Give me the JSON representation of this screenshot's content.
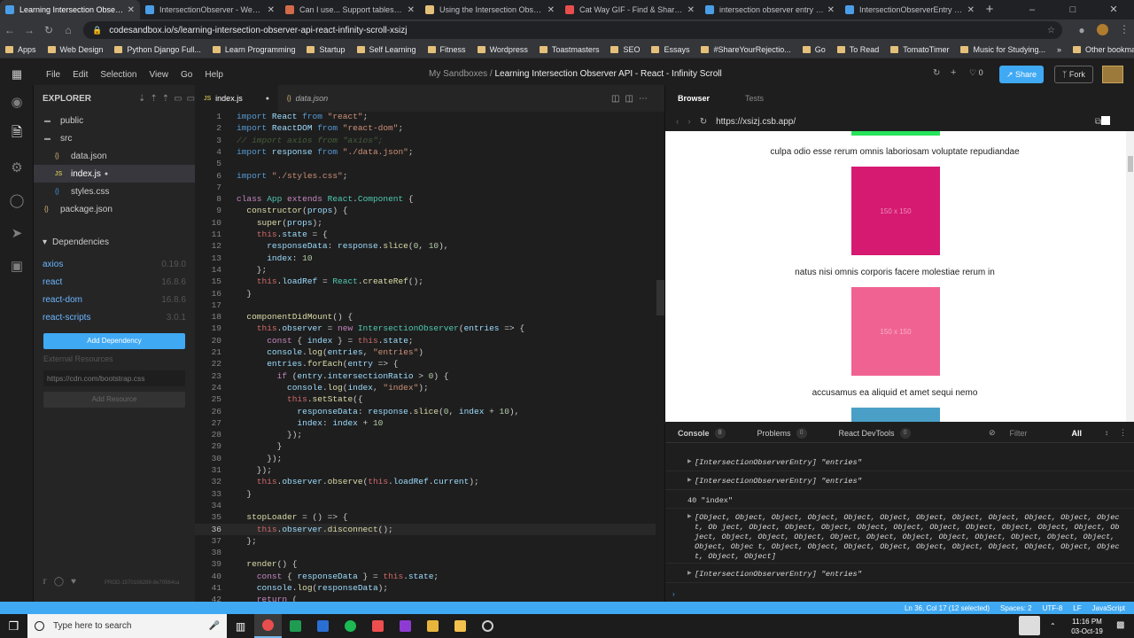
{
  "browser": {
    "tabs": [
      {
        "title": "Learning Intersection Observer A",
        "fav": "#4a9ee8",
        "active": true
      },
      {
        "title": "IntersectionObserver - Web APIs",
        "fav": "#4a9ee8"
      },
      {
        "title": "Can I use... Support tables for HT",
        "fav": "#d36a4a"
      },
      {
        "title": "Using the Intersection Observer",
        "fav": "#e5c07b"
      },
      {
        "title": "Cat Way GIF - Find & Share on Gi",
        "fav": "#e94e4e"
      },
      {
        "title": "intersection observer entry - Goo",
        "fav": "#4a9ee8"
      },
      {
        "title": "IntersectionObserverEntry - Web",
        "fav": "#4a9ee8"
      }
    ],
    "url": "codesandbox.io/s/learning-intersection-observer-api-react-infinity-scroll-xsizj",
    "bookmarks": [
      "Apps",
      "Web Design",
      "Python Django Full...",
      "Learn Programming",
      "Startup",
      "Self Learning",
      "Fitness",
      "Wordpress",
      "Toastmasters",
      "SEO",
      "Essays",
      "#ShareYourRejectio...",
      "Go",
      "To Read",
      "TomatoTimer",
      "Music for Studying..."
    ],
    "other_bookmarks": "Other bookmarks"
  },
  "csb": {
    "menu": [
      "File",
      "Edit",
      "Selection",
      "View",
      "Go",
      "Help"
    ],
    "breadcrumb_prefix": "My Sandboxes /",
    "sandbox_title": "Learning Intersection Observer API - React - Infinity Scroll",
    "likes": "0",
    "share": "Share",
    "fork": "Fork"
  },
  "explorer": {
    "title": "EXPLORER",
    "files": [
      {
        "name": "public",
        "type": "folder",
        "indent": 0
      },
      {
        "name": "src",
        "type": "folder",
        "indent": 0
      },
      {
        "name": "data.json",
        "type": "json",
        "indent": 1
      },
      {
        "name": "index.js",
        "type": "js",
        "indent": 1,
        "active": true
      },
      {
        "name": "styles.css",
        "type": "css",
        "indent": 1
      },
      {
        "name": "package.json",
        "type": "json",
        "indent": 0
      }
    ],
    "dependencies_title": "Dependencies",
    "dependencies": [
      {
        "name": "axios",
        "version": "0.19.0"
      },
      {
        "name": "react",
        "version": "16.8.6"
      },
      {
        "name": "react-dom",
        "version": "16.8.6"
      },
      {
        "name": "react-scripts",
        "version": "3.0.1"
      }
    ],
    "add_dependency": "Add Dependency",
    "external_resources": "External Resources",
    "external_placeholder": "https://cdn.com/bootstrap.css",
    "add_resource": "Add Resource",
    "footer_id": "PROD-1570108289-8e70564ca"
  },
  "editor": {
    "tabs": [
      {
        "name": "index.js",
        "active": true
      },
      {
        "name": "data.json"
      }
    ],
    "current_line": 36,
    "lines": [
      "<span class='k'>import</span> <span class='v'>React</span> <span class='k'>from</span> <span class='s'>\"react\"</span>;",
      "<span class='k'>import</span> <span class='v'>ReactDOM</span> <span class='k'>from</span> <span class='s'>\"react-dom\"</span>;",
      "<span class='c'>// import axios from \"axios\";</span>",
      "<span class='k'>import</span> <span class='v'>response</span> <span class='k'>from</span> <span class='s'>\"./data.json\"</span>;",
      "",
      "<span class='k'>import</span> <span class='s'>\"./styles.css\"</span>;",
      "",
      "<span class='kw'>class</span> <span class='t'>App</span> <span class='kw'>extends</span> <span class='t'>React</span>.<span class='t'>Component</span> {",
      "  <span class='f'>constructor</span>(<span class='v'>props</span>) {",
      "    <span class='f'>super</span>(<span class='v'>props</span>);",
      "    <span class='th'>this</span>.<span class='v'>state</span> = {",
      "      <span class='v'>responseData</span>: <span class='v'>response</span>.<span class='f'>slice</span>(<span class='n'>0</span>, <span class='n'>10</span>),",
      "      <span class='v'>index</span>: <span class='n'>10</span>",
      "    };",
      "    <span class='th'>this</span>.<span class='v'>loadRef</span> = <span class='t'>React</span>.<span class='f'>createRef</span>();",
      "  }",
      "",
      "  <span class='f'>componentDidMount</span>() {",
      "    <span class='th'>this</span>.<span class='v'>observer</span> = <span class='kw'>new</span> <span class='t'>IntersectionObserver</span>(<span class='v'>entries</span> =&gt; {",
      "      <span class='kw'>const</span> { <span class='v'>index</span> } = <span class='th'>this</span>.<span class='v'>state</span>;",
      "      <span class='v'>console</span>.<span class='f'>log</span>(<span class='v'>entries</span>, <span class='s'>\"entries\"</span>)",
      "      <span class='v'>entries</span>.<span class='f'>forEach</span>(<span class='v'>entry</span> =&gt; {",
      "        <span class='kw'>if</span> (<span class='v'>entry</span>.<span class='v'>intersectionRatio</span> &gt; <span class='n'>0</span>) {",
      "          <span class='v'>console</span>.<span class='f'>log</span>(<span class='v'>index</span>, <span class='s'>\"index\"</span>);",
      "          <span class='th'>this</span>.<span class='f'>setState</span>({",
      "            <span class='v'>responseData</span>: <span class='v'>response</span>.<span class='f'>slice</span>(<span class='n'>0</span>, <span class='v'>index</span> + <span class='n'>10</span>),",
      "            <span class='v'>index</span>: <span class='v'>index</span> + <span class='n'>10</span>",
      "          });",
      "        }",
      "      });",
      "    });",
      "    <span class='th'>this</span>.<span class='v'>observer</span>.<span class='f'>observe</span>(<span class='th'>this</span>.<span class='v'>loadRef</span>.<span class='v'>current</span>);",
      "  }",
      "",
      "  <span class='f'>stopLoader</span> = () =&gt; {",
      "    <span class='th'>this</span>.<span class='v'>observer</span>.<span class='f'>disconnect</span>();",
      "  };",
      "",
      "  <span class='f'>render</span>() {",
      "    <span class='kw'>const</span> { <span class='v'>responseData</span> } = <span class='th'>this</span>.<span class='v'>state</span>;",
      "    <span class='v'>console</span>.<span class='f'>log</span>(<span class='v'>responseData</span>);",
      "    <span class='kw'>return</span> ("
    ]
  },
  "preview": {
    "tabs": [
      "Browser",
      "Tests"
    ],
    "url": "https://xsizj.csb.app/",
    "items": [
      {
        "caption": "culpa odio esse rerum omnis laboriosam voluptate repudiandae"
      },
      {
        "color": "#d61a72",
        "placeholder": "150 x 150",
        "caption": "natus nisi omnis corporis facere molestiae rerum in"
      },
      {
        "color": "#f06292",
        "placeholder": "150 x 150",
        "caption": "accusamus ea aliquid et amet sequi nemo"
      },
      {
        "color": "#4a9fc7",
        "placeholder": ""
      }
    ],
    "top_bar_color": "#27e35c"
  },
  "console": {
    "tabs": [
      {
        "label": "Console",
        "count": "0"
      },
      {
        "label": "Problems",
        "count": "0"
      },
      {
        "label": "React DevTools",
        "count": "0"
      }
    ],
    "filter_placeholder": "Filter",
    "level": "All",
    "entries": [
      "[IntersectionObserverEntry] \"entries\"",
      "[IntersectionObserverEntry] \"entries\"",
      "40 \"index\"",
      "[Object, Object, Object, Object, Object, Object, Object, Object, Object, Object, Object, Object, Ob ject, Object, Object, Object, Object, Object, Object, Object, Object, Object, Object, Object, Object, Object, Object, Object, Object, Object, Object, Object, Object, Object, Object, Object, Objec t, Object, Object, Object, Object, Object, Object, Object, Object, Object, Object, Object, Object]",
      "[IntersectionObserverEntry] \"entries\""
    ]
  },
  "status": [
    "Ln 36, Col 17 (12 selected)",
    "Spaces: 2",
    "UTF-8",
    "LF",
    "JavaScript"
  ],
  "taskbar": {
    "search": "Type here to search",
    "time": "11:16 PM",
    "date": "03-Oct-19"
  }
}
